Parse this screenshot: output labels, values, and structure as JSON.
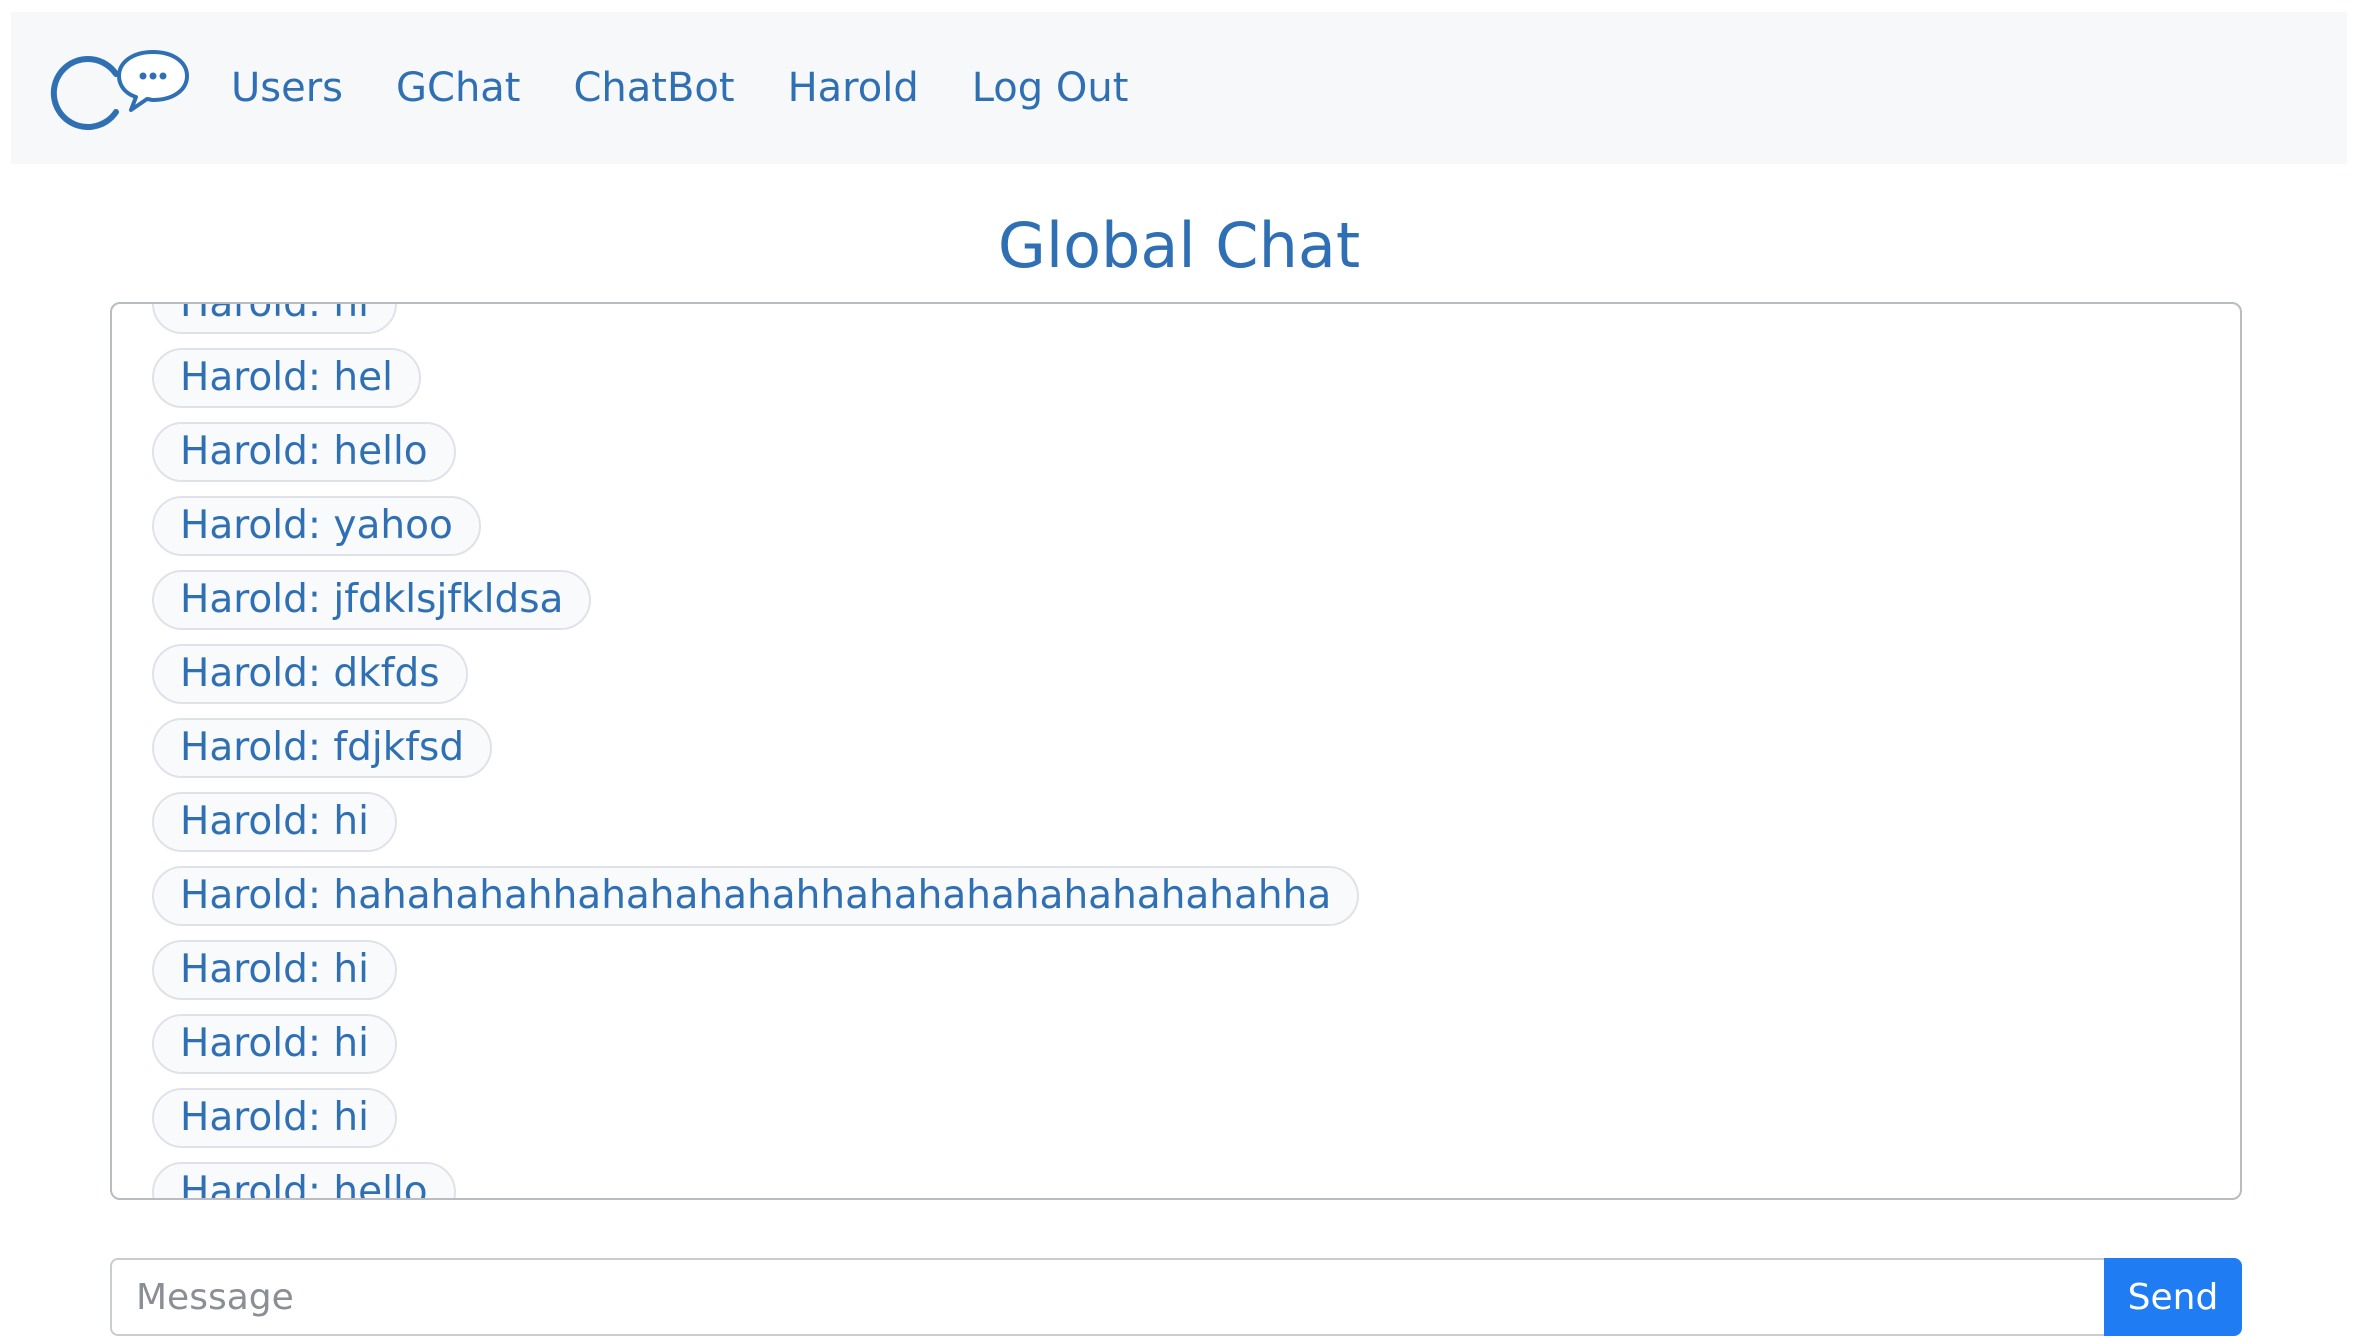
{
  "nav": {
    "logo_icon": "chat-bubble-logo-icon",
    "items": [
      {
        "label": "Users"
      },
      {
        "label": "GChat"
      },
      {
        "label": "ChatBot"
      },
      {
        "label": "Harold"
      },
      {
        "label": "Log Out"
      }
    ]
  },
  "page": {
    "title": "Global Chat"
  },
  "chat": {
    "messages": [
      {
        "text": "Harold: hi"
      },
      {
        "text": "Harold: hel"
      },
      {
        "text": "Harold: hello"
      },
      {
        "text": "Harold: yahoo"
      },
      {
        "text": "Harold: jfdklsjfkldsa"
      },
      {
        "text": "Harold: dkfds"
      },
      {
        "text": "Harold: fdjkfsd"
      },
      {
        "text": "Harold: hi"
      },
      {
        "text": "Harold: hahahahahhahahahahahhahahahahahahahahahha"
      },
      {
        "text": "Harold: hi"
      },
      {
        "text": "Harold: hi"
      },
      {
        "text": "Harold: hi"
      },
      {
        "text": "Harold: hello"
      }
    ]
  },
  "composer": {
    "placeholder": "Message",
    "value": "",
    "send_label": "Send"
  },
  "colors": {
    "accent": "#2f6fb3",
    "button": "#1f7cf3",
    "navbar_bg": "#f7f8fa"
  }
}
